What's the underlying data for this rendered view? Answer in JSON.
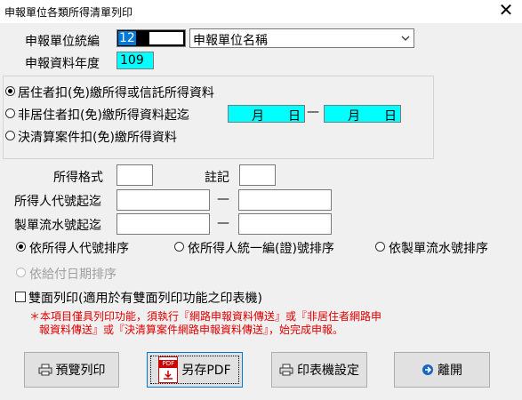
{
  "window": {
    "title": "申報單位各類所得清單列印",
    "close_glyph": "✕"
  },
  "unit": {
    "code_label": "申報單位統編",
    "code_value": "12",
    "name_value": "申報單位名稱",
    "year_label": "申報資料年度",
    "year_value": "109"
  },
  "options": {
    "resident_label": "居住者扣(免)繳所得或信託所得資料",
    "nonresident_label": "非居住者扣(免)繳所得資料起迄",
    "month_label": "月",
    "day_label": "日",
    "closing_label": "決清算案件扣(免)繳所得資料",
    "range_dash": "—"
  },
  "filters": {
    "format_label": "所得格式",
    "note_label": "註記",
    "payee_range_label": "所得人代號起迄",
    "serial_range_label": "製單流水號起迄",
    "range_dash": "—"
  },
  "sort": {
    "by_payee_code": "依所得人代號排序",
    "by_payee_id": "依所得人統一編(證)號排序",
    "by_serial": "依製單流水號排序",
    "by_pay_date": "依給付日期排序"
  },
  "duplex_label": "雙面列印(適用於有雙面列印功能之印表機)",
  "note": {
    "line1": "＊本項目僅具列印功能，須執行『網路申報資料傳送』或『非居住者網路申",
    "line2": "報資料傳送』或『決清算案件網路申報資料傳送』，始完成申報。"
  },
  "buttons": {
    "preview": "預覽列印",
    "save_pdf": "另存PDF",
    "pdf_badge": "PDF",
    "printer_setup": "印表機設定",
    "exit": "離開"
  },
  "colors": {
    "field_highlight": "#00ffff",
    "note_text": "#e00000",
    "selection": "#0078d7"
  }
}
